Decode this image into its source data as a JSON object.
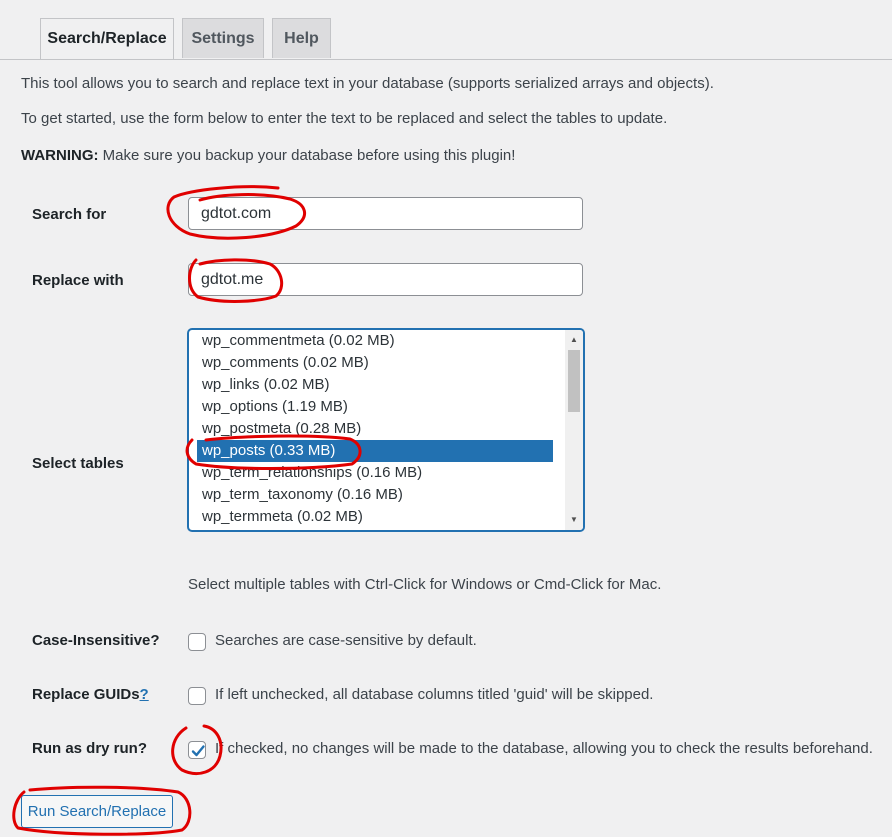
{
  "tabs": [
    {
      "label": "Search/Replace",
      "active": true
    },
    {
      "label": "Settings",
      "active": false
    },
    {
      "label": "Help",
      "active": false
    }
  ],
  "intro": {
    "line1": "This tool allows you to search and replace text in your database (supports serialized arrays and objects).",
    "line2": "To get started, use the form below to enter the text to be replaced and select the tables to update.",
    "warning_label": "WARNING:",
    "warning_text": " Make sure you backup your database before using this plugin!"
  },
  "form": {
    "search_label": "Search for",
    "search_value": "gdtot.com",
    "replace_label": "Replace with",
    "replace_value": "gdtot.me",
    "tables_label": "Select tables",
    "tables": [
      "wp_commentmeta (0.02 MB)",
      "wp_comments (0.02 MB)",
      "wp_links (0.02 MB)",
      "wp_options (1.19 MB)",
      "wp_postmeta (0.28 MB)",
      "wp_posts (0.33 MB)",
      "wp_term_relationships (0.16 MB)",
      "wp_term_taxonomy (0.16 MB)",
      "wp_termmeta (0.02 MB)"
    ],
    "selected_table": "wp_posts (0.33 MB)",
    "tables_hint": "Select multiple tables with Ctrl-Click for Windows or Cmd-Click for Mac.",
    "case_label": "Case-Insensitive?",
    "case_text": "Searches are case-sensitive by default.",
    "case_checked": false,
    "guid_label_text": "Replace GUIDs",
    "guid_label_link": "?",
    "guid_text": "If left unchecked, all database columns titled 'guid' will be skipped.",
    "guid_checked": false,
    "dry_label": "Run as dry run?",
    "dry_text": "If checked, no changes will be made to the database, allowing you to check the results beforehand.",
    "dry_checked": true,
    "run_button": "Run Search/Replace"
  },
  "colors": {
    "accent": "#2271b1",
    "annotation": "#e00000",
    "background": "#f0f0f1"
  }
}
